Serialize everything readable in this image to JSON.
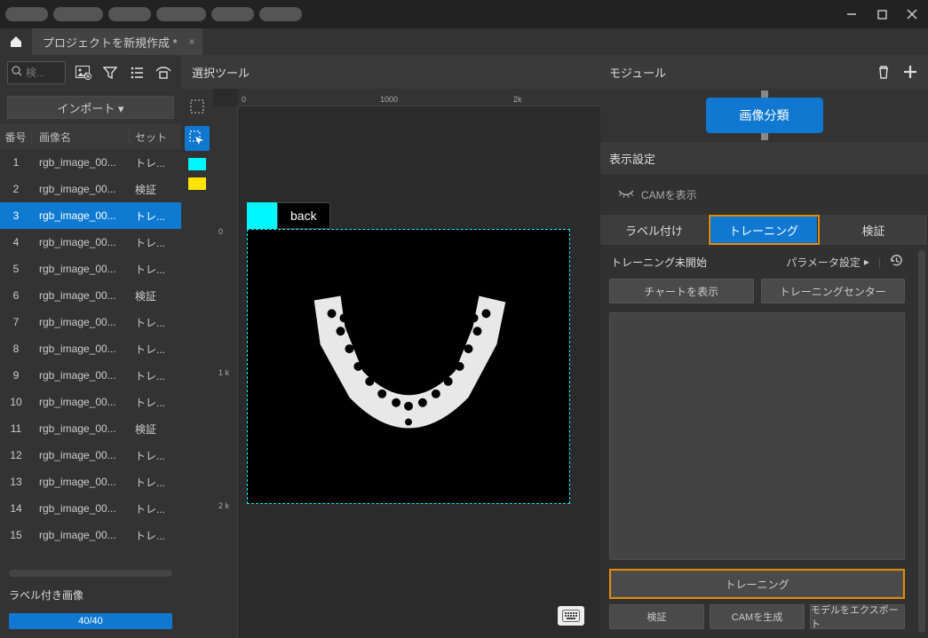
{
  "window": {
    "project_tab": "プロジェクトを新規作成 *"
  },
  "left": {
    "search_placeholder": "検...",
    "import_button": "インポート ▾",
    "columns": {
      "num": "番号",
      "name": "画像名",
      "set": "セット"
    },
    "rows": [
      {
        "n": "1",
        "name": "rgb_image_00...",
        "set": "トレ..."
      },
      {
        "n": "2",
        "name": "rgb_image_00...",
        "set": "検証"
      },
      {
        "n": "3",
        "name": "rgb_image_00...",
        "set": "トレ...",
        "selected": true
      },
      {
        "n": "4",
        "name": "rgb_image_00...",
        "set": "トレ..."
      },
      {
        "n": "5",
        "name": "rgb_image_00...",
        "set": "トレ..."
      },
      {
        "n": "6",
        "name": "rgb_image_00...",
        "set": "検証"
      },
      {
        "n": "7",
        "name": "rgb_image_00...",
        "set": "トレ..."
      },
      {
        "n": "8",
        "name": "rgb_image_00...",
        "set": "トレ..."
      },
      {
        "n": "9",
        "name": "rgb_image_00...",
        "set": "トレ..."
      },
      {
        "n": "10",
        "name": "rgb_image_00...",
        "set": "トレ..."
      },
      {
        "n": "11",
        "name": "rgb_image_00...",
        "set": "検証"
      },
      {
        "n": "12",
        "name": "rgb_image_00...",
        "set": "トレ..."
      },
      {
        "n": "13",
        "name": "rgb_image_00...",
        "set": "トレ..."
      },
      {
        "n": "14",
        "name": "rgb_image_00...",
        "set": "トレ..."
      },
      {
        "n": "15",
        "name": "rgb_image_00...",
        "set": "トレ..."
      }
    ],
    "labeled_images": "ラベル付き画像",
    "progress": "40/40"
  },
  "center": {
    "title": "選択ツール",
    "label_text": "back",
    "swatches": {
      "active": "#00f6ff",
      "second": "#ffe400"
    },
    "ruler_h": {
      "t0": "0",
      "t1": "1000",
      "t2": "2k"
    },
    "ruler_v": {
      "t0": "0",
      "t1": "1\nk",
      "t2": "2\nk"
    }
  },
  "right": {
    "module_header": "モジュール",
    "module_node": "画像分類",
    "display_header": "表示設定",
    "cam_show": "CAMを表示",
    "tabs": {
      "label": "ラベル付け",
      "train": "トレーニング",
      "verify": "検証"
    },
    "train_status": "トレーニング未開始",
    "param_link": "パラメータ設定",
    "chart_btn": "チャートを表示",
    "center_btn": "トレーニングセンター",
    "train_button": "トレーニング",
    "verify_btn": "検証",
    "cam_gen_btn": "CAMを生成",
    "export_btn": "モデルをエクスポート"
  }
}
